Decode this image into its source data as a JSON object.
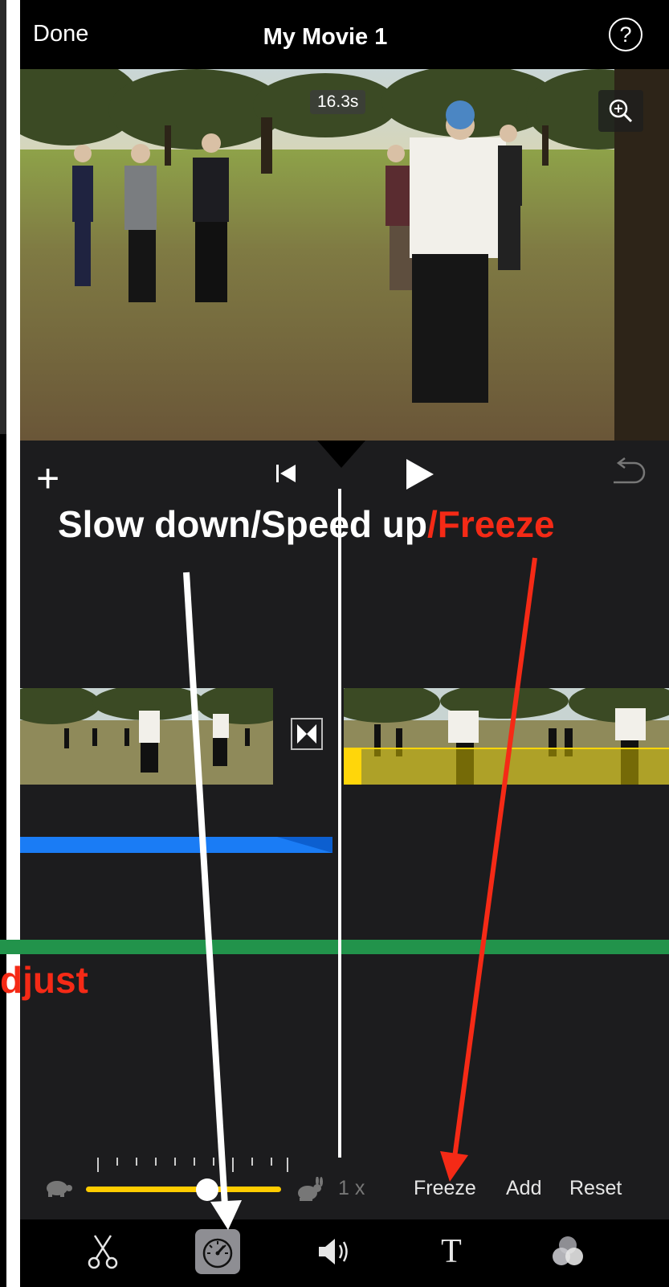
{
  "header": {
    "done_label": "Done",
    "title": "My Movie 1",
    "help_label": "?"
  },
  "preview": {
    "duration": "16.3s",
    "zoom_icon": "zoom-in-icon"
  },
  "timeline": {
    "add_icon": "plus-icon",
    "skip_icon": "skip-to-start-icon",
    "play_icon": "play-icon",
    "undo_icon": "undo-icon",
    "transition_icon": "transition-icon",
    "audio_track_colors": [
      "#1a7cf5",
      "#22934b"
    ],
    "selected_clip_color": "#ffd60a"
  },
  "speed": {
    "value_label": "1 x",
    "slider_level": 0.62,
    "freeze_label": "Freeze",
    "add_label": "Add",
    "reset_label": "Reset"
  },
  "toolbar": {
    "tools": [
      "scissors-icon",
      "speedometer-icon",
      "volume-icon",
      "text-icon",
      "filter-icon"
    ],
    "active": "speedometer-icon"
  },
  "annotations": {
    "caption_main": "Slow down/Speed up",
    "caption_freeze": "/Freeze",
    "adjust_label": "djust",
    "colors": {
      "white": "#ffffff",
      "red": "#f52a16"
    }
  }
}
